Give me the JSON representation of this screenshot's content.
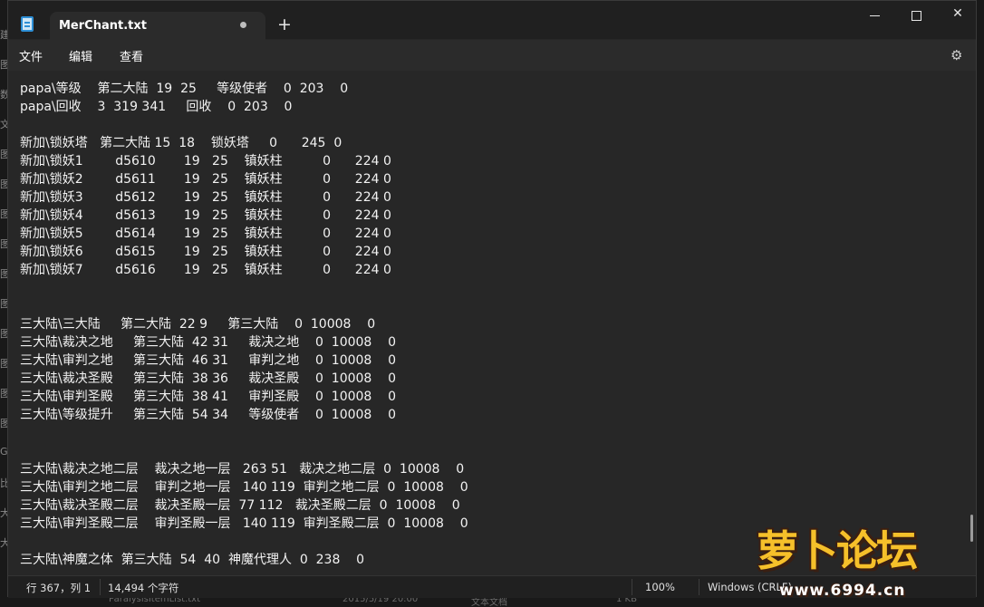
{
  "window": {
    "tab_title": "MerChant.txt",
    "new_tab": "+",
    "close_symbol": "✕"
  },
  "menu": {
    "file": "文件",
    "edit": "编辑",
    "view": "查看"
  },
  "background": {
    "left_chars": [
      "建",
      "图",
      "数",
      "文",
      "图",
      "图",
      "图",
      "图",
      "图",
      "图",
      "图",
      "图",
      "图",
      "图",
      "G",
      "比",
      "大",
      "大"
    ],
    "bottom_file": "ParalysisItemList.txt",
    "bottom_date": "2015/5/19 20:00",
    "bottom_type": "文本文档",
    "bottom_size": "1 KB"
  },
  "lines": [
    "papa\\等级    第二大陆  19  25     等级使者    0  203    0",
    "papa\\回收    3  319 341     回收    0  203    0",
    "",
    "新加\\锁妖塔   第二大陆 15  18    锁妖塔     0      245  0",
    "新加\\锁妖1        d5610       19   25    镇妖柱          0      224 0",
    "新加\\锁妖2        d5611       19   25    镇妖柱          0      224 0",
    "新加\\锁妖3        d5612       19   25    镇妖柱          0      224 0",
    "新加\\锁妖4        d5613       19   25    镇妖柱          0      224 0",
    "新加\\锁妖5        d5614       19   25    镇妖柱          0      224 0",
    "新加\\锁妖6        d5615       19   25    镇妖柱          0      224 0",
    "新加\\锁妖7        d5616       19   25    镇妖柱          0      224 0",
    "",
    "",
    "三大陆\\三大陆     第二大陆  22 9     第三大陆    0  10008    0",
    "三大陆\\裁决之地     第三大陆  42 31     裁决之地    0  10008    0",
    "三大陆\\审判之地     第三大陆  46 31     审判之地    0  10008    0",
    "三大陆\\裁决圣殿     第三大陆  38 36     裁决圣殿    0  10008    0",
    "三大陆\\审判圣殿     第三大陆  38 41     审判圣殿    0  10008    0",
    "三大陆\\等级提升     第三大陆  54 34     等级使者    0  10008    0",
    "",
    "",
    "三大陆\\裁决之地二层    裁决之地一层   263 51   裁决之地二层  0  10008    0",
    "三大陆\\审判之地二层    审判之地一层   140 119  审判之地二层  0  10008    0",
    "三大陆\\裁决圣殿二层    裁决圣殿一层  77 112   裁决圣殿二层  0  10008    0",
    "三大陆\\审判圣殿二层    审判圣殿一层   140 119  审判圣殿二层  0  10008    0",
    "",
    "三大陆\\神魔之体  第三大陆  54  40  神魔代理人  0  238    0"
  ],
  "status": {
    "position": "行 367，列 1",
    "chars": "14,494 个字符",
    "zoom": "100%",
    "eol": "Windows (CRLF)"
  },
  "watermark": {
    "brand": "萝卜论坛",
    "url": "www.6994.cn"
  }
}
